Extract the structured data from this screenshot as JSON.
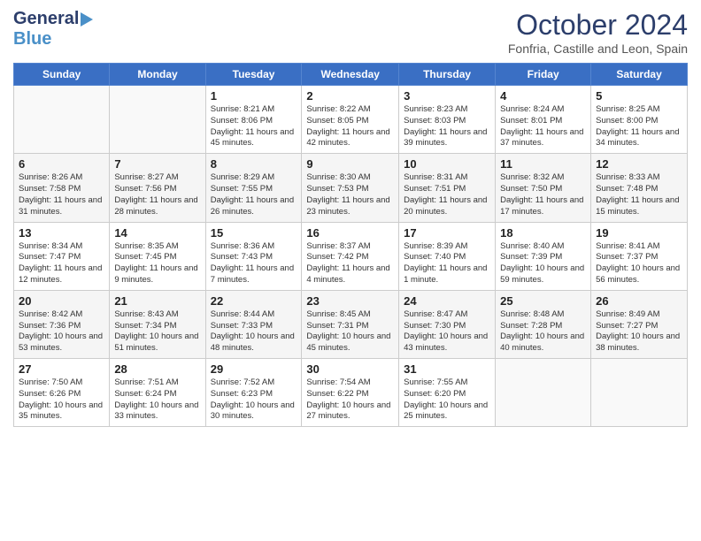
{
  "header": {
    "logo_line1": "General",
    "logo_line2": "Blue",
    "month": "October 2024",
    "location": "Fonfria, Castille and Leon, Spain"
  },
  "weekdays": [
    "Sunday",
    "Monday",
    "Tuesday",
    "Wednesday",
    "Thursday",
    "Friday",
    "Saturday"
  ],
  "weeks": [
    [
      {
        "day": "",
        "info": ""
      },
      {
        "day": "",
        "info": ""
      },
      {
        "day": "1",
        "info": "Sunrise: 8:21 AM\nSunset: 8:06 PM\nDaylight: 11 hours and 45 minutes."
      },
      {
        "day": "2",
        "info": "Sunrise: 8:22 AM\nSunset: 8:05 PM\nDaylight: 11 hours and 42 minutes."
      },
      {
        "day": "3",
        "info": "Sunrise: 8:23 AM\nSunset: 8:03 PM\nDaylight: 11 hours and 39 minutes."
      },
      {
        "day": "4",
        "info": "Sunrise: 8:24 AM\nSunset: 8:01 PM\nDaylight: 11 hours and 37 minutes."
      },
      {
        "day": "5",
        "info": "Sunrise: 8:25 AM\nSunset: 8:00 PM\nDaylight: 11 hours and 34 minutes."
      }
    ],
    [
      {
        "day": "6",
        "info": "Sunrise: 8:26 AM\nSunset: 7:58 PM\nDaylight: 11 hours and 31 minutes."
      },
      {
        "day": "7",
        "info": "Sunrise: 8:27 AM\nSunset: 7:56 PM\nDaylight: 11 hours and 28 minutes."
      },
      {
        "day": "8",
        "info": "Sunrise: 8:29 AM\nSunset: 7:55 PM\nDaylight: 11 hours and 26 minutes."
      },
      {
        "day": "9",
        "info": "Sunrise: 8:30 AM\nSunset: 7:53 PM\nDaylight: 11 hours and 23 minutes."
      },
      {
        "day": "10",
        "info": "Sunrise: 8:31 AM\nSunset: 7:51 PM\nDaylight: 11 hours and 20 minutes."
      },
      {
        "day": "11",
        "info": "Sunrise: 8:32 AM\nSunset: 7:50 PM\nDaylight: 11 hours and 17 minutes."
      },
      {
        "day": "12",
        "info": "Sunrise: 8:33 AM\nSunset: 7:48 PM\nDaylight: 11 hours and 15 minutes."
      }
    ],
    [
      {
        "day": "13",
        "info": "Sunrise: 8:34 AM\nSunset: 7:47 PM\nDaylight: 11 hours and 12 minutes."
      },
      {
        "day": "14",
        "info": "Sunrise: 8:35 AM\nSunset: 7:45 PM\nDaylight: 11 hours and 9 minutes."
      },
      {
        "day": "15",
        "info": "Sunrise: 8:36 AM\nSunset: 7:43 PM\nDaylight: 11 hours and 7 minutes."
      },
      {
        "day": "16",
        "info": "Sunrise: 8:37 AM\nSunset: 7:42 PM\nDaylight: 11 hours and 4 minutes."
      },
      {
        "day": "17",
        "info": "Sunrise: 8:39 AM\nSunset: 7:40 PM\nDaylight: 11 hours and 1 minute."
      },
      {
        "day": "18",
        "info": "Sunrise: 8:40 AM\nSunset: 7:39 PM\nDaylight: 10 hours and 59 minutes."
      },
      {
        "day": "19",
        "info": "Sunrise: 8:41 AM\nSunset: 7:37 PM\nDaylight: 10 hours and 56 minutes."
      }
    ],
    [
      {
        "day": "20",
        "info": "Sunrise: 8:42 AM\nSunset: 7:36 PM\nDaylight: 10 hours and 53 minutes."
      },
      {
        "day": "21",
        "info": "Sunrise: 8:43 AM\nSunset: 7:34 PM\nDaylight: 10 hours and 51 minutes."
      },
      {
        "day": "22",
        "info": "Sunrise: 8:44 AM\nSunset: 7:33 PM\nDaylight: 10 hours and 48 minutes."
      },
      {
        "day": "23",
        "info": "Sunrise: 8:45 AM\nSunset: 7:31 PM\nDaylight: 10 hours and 45 minutes."
      },
      {
        "day": "24",
        "info": "Sunrise: 8:47 AM\nSunset: 7:30 PM\nDaylight: 10 hours and 43 minutes."
      },
      {
        "day": "25",
        "info": "Sunrise: 8:48 AM\nSunset: 7:28 PM\nDaylight: 10 hours and 40 minutes."
      },
      {
        "day": "26",
        "info": "Sunrise: 8:49 AM\nSunset: 7:27 PM\nDaylight: 10 hours and 38 minutes."
      }
    ],
    [
      {
        "day": "27",
        "info": "Sunrise: 7:50 AM\nSunset: 6:26 PM\nDaylight: 10 hours and 35 minutes."
      },
      {
        "day": "28",
        "info": "Sunrise: 7:51 AM\nSunset: 6:24 PM\nDaylight: 10 hours and 33 minutes."
      },
      {
        "day": "29",
        "info": "Sunrise: 7:52 AM\nSunset: 6:23 PM\nDaylight: 10 hours and 30 minutes."
      },
      {
        "day": "30",
        "info": "Sunrise: 7:54 AM\nSunset: 6:22 PM\nDaylight: 10 hours and 27 minutes."
      },
      {
        "day": "31",
        "info": "Sunrise: 7:55 AM\nSunset: 6:20 PM\nDaylight: 10 hours and 25 minutes."
      },
      {
        "day": "",
        "info": ""
      },
      {
        "day": "",
        "info": ""
      }
    ]
  ]
}
